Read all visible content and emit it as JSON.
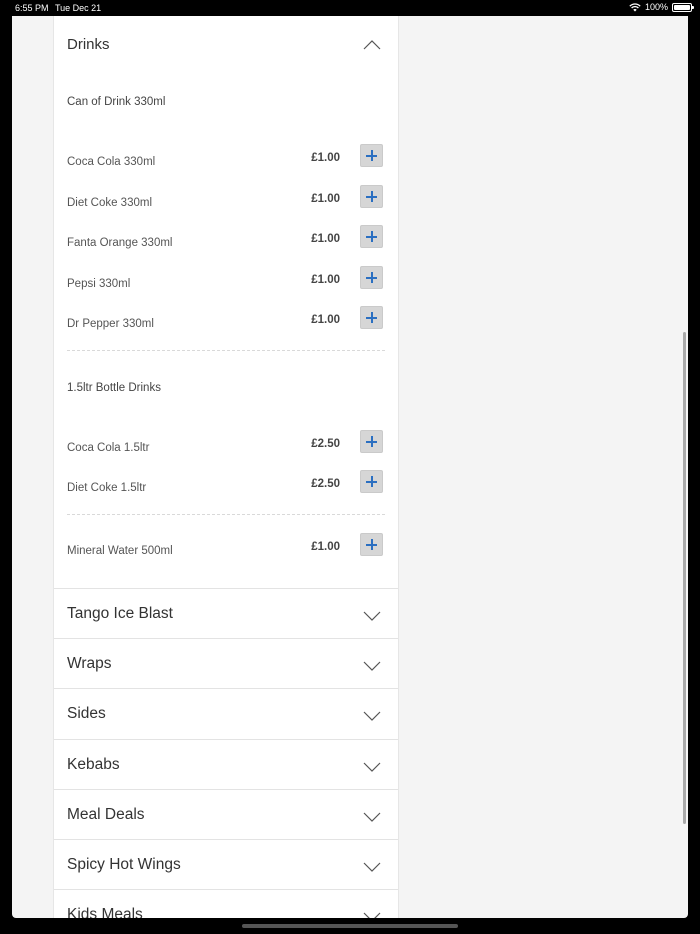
{
  "status_bar": {
    "time": "6:55 PM",
    "date": "Tue Dec 21",
    "battery": "100%"
  },
  "menu": {
    "open_section": "Drinks",
    "groups": [
      {
        "title": "Can of Drink 330ml",
        "items": [
          {
            "name": "Coca Cola 330ml",
            "price": "£1.00"
          },
          {
            "name": "Diet Coke 330ml",
            "price": "£1.00"
          },
          {
            "name": "Fanta Orange 330ml",
            "price": "£1.00"
          },
          {
            "name": "Pepsi 330ml",
            "price": "£1.00"
          },
          {
            "name": "Dr Pepper 330ml",
            "price": "£1.00"
          }
        ]
      },
      {
        "title": "1.5ltr Bottle Drinks",
        "items": [
          {
            "name": "Coca Cola 1.5ltr",
            "price": "£2.50"
          },
          {
            "name": "Diet Coke 1.5ltr",
            "price": "£2.50"
          }
        ]
      },
      {
        "title": "",
        "items": [
          {
            "name": "Mineral Water 500ml",
            "price": "£1.00"
          }
        ]
      }
    ],
    "categories": [
      "Tango Ice Blast",
      "Wraps",
      "Sides",
      "Kebabs",
      "Meal Deals",
      "Spicy Hot Wings",
      "Kids Meals"
    ]
  },
  "colors": {
    "accent": "#2b6fc1",
    "button_bg": "#d6d6d6",
    "page_bg": "#f4f4f4"
  },
  "icons": {
    "expanded": "chevron-up-icon",
    "collapsed": "chevron-down-icon",
    "add": "plus-icon"
  }
}
